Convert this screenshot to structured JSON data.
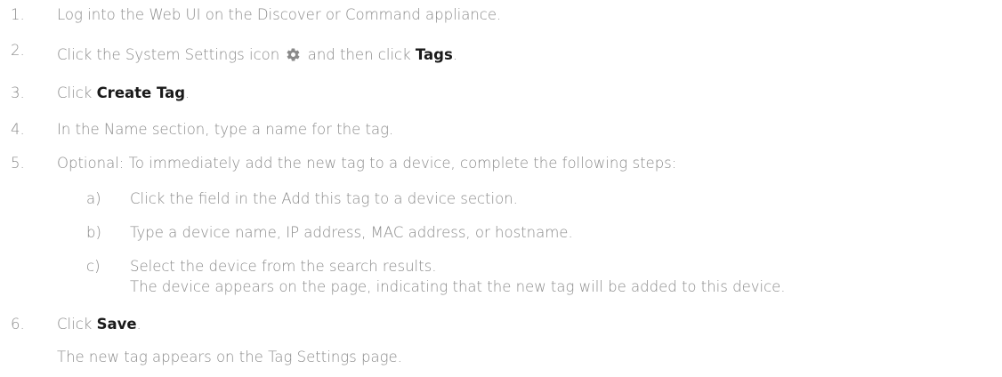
{
  "steps": [
    {
      "num": "1.",
      "text": "Log into the Web UI on the Discover or Command appliance."
    },
    {
      "num": "2.",
      "pre": "Click the System Settings icon",
      "mid": "and then click",
      "strong": "Tags",
      "post": ".",
      "icon": "gear-icon"
    },
    {
      "num": "3.",
      "pre": "Click",
      "strong": "Create Tag",
      "post": "."
    },
    {
      "num": "4.",
      "text": "In the Name section, type a name for the tag."
    },
    {
      "num": "5.",
      "text": "Optional: To immediately add the new tag to a device, complete the following steps:",
      "substeps": [
        {
          "num": "a)",
          "text": "Click the field in the Add this tag to a device section."
        },
        {
          "num": "b)",
          "text": "Type a device name, IP address, MAC address, or hostname."
        },
        {
          "num": "c)",
          "text": "Select the device from the search results.",
          "note": "The device appears on the page, indicating that the new tag will be added to this device."
        }
      ]
    },
    {
      "num": "6.",
      "pre": "Click",
      "strong": "Save",
      "post": ".",
      "note": "The new tag appears on the Tag Settings page."
    }
  ],
  "colors": {
    "text": "#8a8a8a",
    "strong": "#1a1a1a",
    "icon": "#8a8a8a"
  }
}
